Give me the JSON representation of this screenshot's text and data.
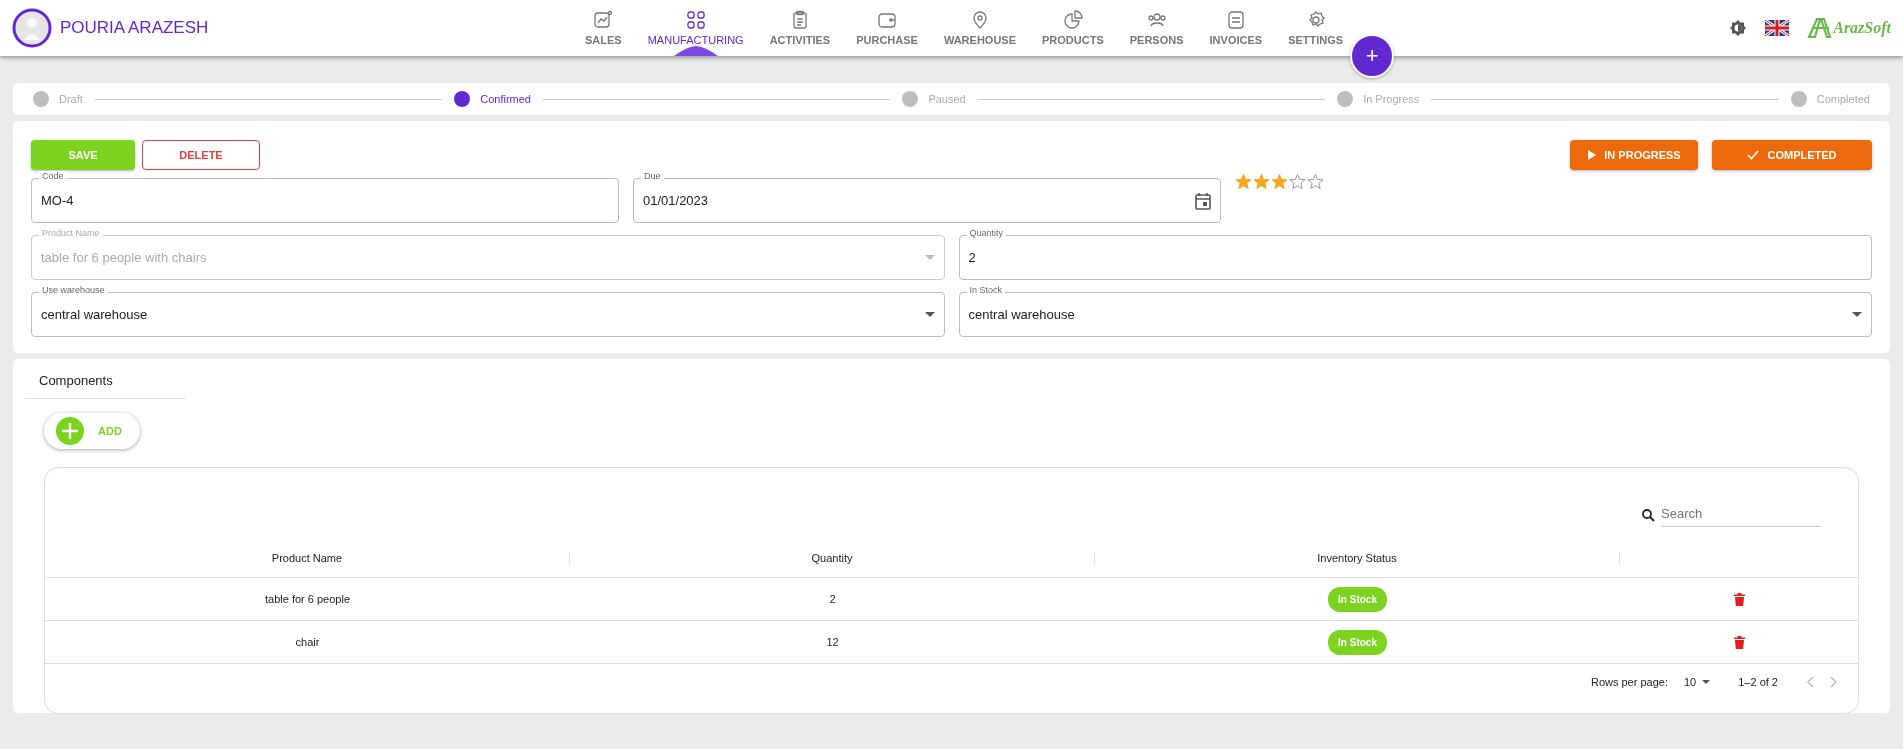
{
  "user": {
    "name": "POURIA ARAZESH"
  },
  "nav": [
    {
      "label": "SALES",
      "selected": false
    },
    {
      "label": "MANUFACTURING",
      "selected": true
    },
    {
      "label": "ACTIVITIES",
      "selected": false
    },
    {
      "label": "PURCHASE",
      "selected": false
    },
    {
      "label": "WAREHOUSE",
      "selected": false
    },
    {
      "label": "PRODUCTS",
      "selected": false
    },
    {
      "label": "PERSONS",
      "selected": false
    },
    {
      "label": "INVOICES",
      "selected": false
    },
    {
      "label": "SETTINGS",
      "selected": false
    }
  ],
  "fab": {
    "label": "+"
  },
  "logo": {
    "text": "ArazSoft"
  },
  "steps": [
    {
      "label": "Draft",
      "selected": false
    },
    {
      "label": "Confirmed",
      "selected": true
    },
    {
      "label": "Paused",
      "selected": false
    },
    {
      "label": "In Progress",
      "selected": false
    },
    {
      "label": "Completed",
      "selected": false
    }
  ],
  "left_actions": [
    {
      "label": "SAVE",
      "kind": "primary"
    },
    {
      "label": "DELETE",
      "kind": "outline"
    }
  ],
  "right_actions": [
    {
      "label": "IN PROGRESS",
      "kind": "play"
    },
    {
      "label": "COMPLETED",
      "kind": "check"
    }
  ],
  "rating": {
    "stars": 3
  },
  "field_rows": [
    {
      "fields": [
        {
          "label": "Code",
          "value": "MO-4",
          "kind": "text",
          "disabled": false
        },
        {
          "label": "Due",
          "value": "01/01/2023",
          "kind": "date",
          "disabled": false
        }
      ]
    },
    {
      "fields": [
        {
          "label": "Product Name",
          "value": "table for 6 people with chairs",
          "kind": "select",
          "disabled": true
        },
        {
          "label": "Quantity",
          "value": "2",
          "kind": "text",
          "disabled": false
        }
      ]
    },
    {
      "fields": [
        {
          "label": "Use warehouse",
          "value": "central warehouse",
          "kind": "select",
          "disabled": false
        },
        {
          "label": "In Stock",
          "value": "central warehouse",
          "kind": "select",
          "disabled": false
        }
      ]
    }
  ],
  "components": {
    "title": "Components",
    "add_label": "ADD",
    "search": {
      "placeholder": "Search"
    },
    "columns": [
      "Product Name",
      "Quantity",
      "Inventory Status"
    ],
    "rows": [
      {
        "product": "table for 6 people",
        "quantity": "2",
        "status": "In Stock"
      },
      {
        "product": "chair",
        "quantity": "12",
        "status": "In Stock"
      }
    ],
    "pagination": {
      "rows_label": "Rows per page:",
      "rows_value": "10",
      "range": "1–2 of 2"
    }
  }
}
